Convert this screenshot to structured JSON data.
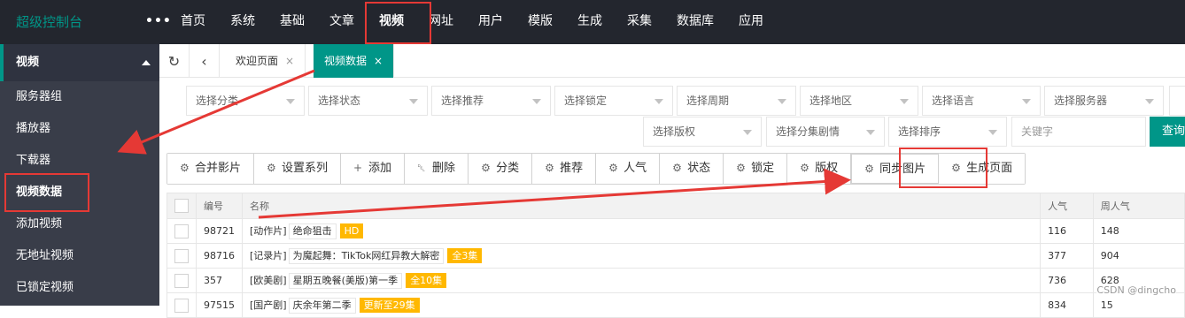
{
  "app": {
    "logo": "超级控制台",
    "more": "•••",
    "nav": [
      "首页",
      "系统",
      "基础",
      "文章",
      "视频",
      "网址",
      "用户",
      "模版",
      "生成",
      "采集",
      "数据库",
      "应用"
    ],
    "nav_active": "视频"
  },
  "sidebar": {
    "section": "视频",
    "items": [
      "服务器组",
      "播放器",
      "下载器",
      "视频数据",
      "添加视频",
      "无地址视频",
      "已锁定视频"
    ]
  },
  "tabs": {
    "refresh_icon": "refresh-icon",
    "back_icon": "chevron-left-icon",
    "items": [
      {
        "label": "欢迎页面",
        "close": "×"
      },
      {
        "label": "视频数据",
        "close": "×"
      }
    ]
  },
  "filters": {
    "row1": [
      "选择分类",
      "选择状态",
      "选择推荐",
      "选择锁定",
      "选择周期",
      "选择地区",
      "选择语言",
      "选择服务器"
    ],
    "row2": [
      "选择版权",
      "选择分集剧情",
      "选择排序"
    ],
    "keyword_placeholder": "关键字",
    "query": "查询"
  },
  "toolbar": [
    {
      "icon": "gear-icon",
      "label": "合并影片"
    },
    {
      "icon": "gear-icon",
      "label": "设置系列"
    },
    {
      "icon": "plus-icon",
      "label": "添加"
    },
    {
      "icon": "trash-icon",
      "label": "删除"
    },
    {
      "icon": "gear-icon",
      "label": "分类"
    },
    {
      "icon": "gear-icon",
      "label": "推荐"
    },
    {
      "icon": "gear-icon",
      "label": "人气"
    },
    {
      "icon": "gear-icon",
      "label": "状态"
    },
    {
      "icon": "gear-icon",
      "label": "锁定"
    },
    {
      "icon": "gear-icon",
      "label": "版权"
    },
    {
      "icon": "gear-icon",
      "label": "同步图片"
    },
    {
      "icon": "gear-icon",
      "label": "生成页面"
    }
  ],
  "table": {
    "headers": [
      "编号",
      "名称",
      "人气",
      "周人气"
    ],
    "rows": [
      {
        "id": "98721",
        "type": "[动作片]",
        "name": "绝命狙击",
        "badge": "HD",
        "hits": "116",
        "week": "148"
      },
      {
        "id": "98716",
        "type": "[记录片]",
        "name": "为魔起舞：TikTok网红异教大解密",
        "badge": "全3集",
        "hits": "377",
        "week": "904"
      },
      {
        "id": "357",
        "type": "[欧美剧]",
        "name": "星期五晚餐(美版)第一季",
        "badge": "全10集",
        "hits": "736",
        "week": "628"
      },
      {
        "id": "97515",
        "type": "[国产剧]",
        "name": "庆余年第二季",
        "badge": "更新至29集",
        "hits": "834",
        "week": "15"
      }
    ]
  },
  "watermark": "CSDN @dingcho",
  "colors": {
    "accent": "#009688",
    "topbar": "#23262e",
    "sidebar": "#393d49",
    "badge": "#ffb800",
    "highlight": "#e53935"
  }
}
